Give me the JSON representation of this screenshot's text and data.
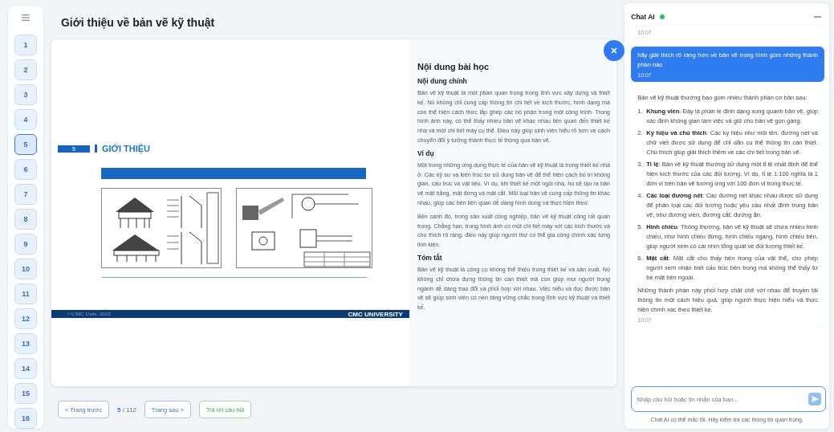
{
  "sidebar": {
    "pages": [
      {
        "label": "1",
        "selected": false
      },
      {
        "label": "2",
        "selected": false
      },
      {
        "label": "3",
        "selected": false
      },
      {
        "label": "4",
        "selected": false
      },
      {
        "label": "5",
        "selected": true
      },
      {
        "label": "6",
        "selected": false
      },
      {
        "label": "7",
        "selected": false
      },
      {
        "label": "8",
        "selected": false
      },
      {
        "label": "9",
        "selected": false
      },
      {
        "label": "10",
        "selected": false
      },
      {
        "label": "11",
        "selected": false
      },
      {
        "label": "12",
        "selected": false
      },
      {
        "label": "13",
        "selected": false
      },
      {
        "label": "14",
        "selected": false
      },
      {
        "label": "15",
        "selected": false
      },
      {
        "label": "16",
        "selected": false
      }
    ]
  },
  "header": {
    "title": "Giới thiệu về bản vẽ kỹ thuật"
  },
  "slide": {
    "number": "5",
    "heading": "GIỚI THIỆU",
    "footer_left": "©CMC Univ. 2022",
    "footer_right": "CMC UNIVERSITY"
  },
  "lesson": {
    "title": "Nội dung bài học",
    "sections": [
      {
        "heading": "Nội dung chính",
        "paragraphs": [
          "Bản vẽ kỹ thuật là một phần quan trọng trong lĩnh vực xây dựng và thiết kế. Nó không chỉ cung cấp thông tin chi tiết về kích thước, hình dạng mà còn thể hiện cách thức lắp ghép các bộ phận trong một công trình. Trong hình ảnh này, có thể thấy nhiều bản vẽ khác nhau liên quan đến thiết kế nhà và một chi tiết máy cụ thể. Điều này giúp sinh viên hiểu rõ hơn về cách chuyển đổi ý tưởng thành thực tế thông qua bản vẽ."
        ]
      },
      {
        "heading": "Ví dụ",
        "paragraphs": [
          "Một trong những ứng dụng thực tế của bản vẽ kỹ thuật là trong thiết kế nhà ở. Các kỹ sư và kiến trúc sư sử dụng bản vẽ để thể hiện cách bố trí không gian, cấu trúc và vật liệu. Ví dụ, khi thiết kế một ngôi nhà, họ sẽ tạo ra bản vẽ mặt bằng, mặt đứng và mặt cắt. Mỗi loại bản vẽ cung cấp thông tin khác nhau, giúp các bên liên quan dễ dàng hình dung và thực hiện theo.",
          "Bên cạnh đó, trong sản xuất công nghiệp, bản vẽ kỹ thuật cũng rất quan trọng. Chẳng hạn, trong hình ảnh có một chi tiết máy với các kích thước và chú thích rõ ràng, điều này giúp người thợ có thể gia công chính xác từng linh kiện."
        ]
      },
      {
        "heading": "Tóm tắt",
        "paragraphs": [
          "Bản vẽ kỹ thuật là công cụ không thể thiếu trong thiết kế và sản xuất. Nó không chỉ chứa đựng thông tin cần thiết mà còn giúp mọi người trong ngành dễ dàng trao đổi và phối hợp với nhau. Việc hiểu và đọc được bản vẽ sẽ giúp sinh viên có nền tảng vững chắc trong lĩnh vực kỹ thuật và thiết kế."
        ]
      }
    ]
  },
  "pager": {
    "prev": "< Trang trước",
    "current": "5",
    "total": "/ 112",
    "next": "Trang sau >",
    "answer": "Trả lời câu hỏi"
  },
  "chat": {
    "title": "Chat AI",
    "online": true,
    "messages": [
      {
        "kind": "bot",
        "time": "10:07"
      },
      {
        "kind": "user",
        "text": "hãy giải thích rõ ràng hơn về bản vẽ trong hình gồm những thành phần nào",
        "time": "10:07"
      },
      {
        "kind": "bot",
        "intro": "Bản vẽ kỹ thuật thường bao gồm nhiều thành phần cơ bản sau:",
        "items": [
          {
            "number": "1.",
            "text": "**Khung viền**: Đây là phần lề định dạng xung quanh bản vẽ, giúp xác định không gian làm việc và giữ cho bản vẽ gọn gàng."
          },
          {
            "number": "2.",
            "text": "**Ký hiệu và chú thích**: Các ký hiệu như mũi tên, đường nét và chữ viết được sử dụng để chỉ dẫn cụ thể thông tin cần thiết. Chú thích giúp giải thích thêm về các chi tiết trong bản vẽ."
          },
          {
            "number": "3.",
            "text": "**Tỉ lệ**: Bản vẽ kỹ thuật thường sử dụng một tỉ lệ nhất định để thể hiện kích thước của các đối tượng. Ví dụ, tỉ lệ 1:100 nghĩa là 1 đơn vị trên bản vẽ tương ứng với 100 đơn vị trong thực tế."
          },
          {
            "number": "4.",
            "text": "**Các loại đường nét**: Các đường nét khác nhau được sử dụng để phân loại các đối tượng hoặc yêu cầu nhất định trong bản vẽ, như đường viền, đường cắt, đường ẩn."
          },
          {
            "number": "5.",
            "text": "**Hình chiếu**: Thông thường, bản vẽ kỹ thuật sẽ chứa nhiều hình chiếu, như hình chiếu đứng, hình chiếu ngang, hình chiếu bên, giúp người xem có cái nhìn tổng quát về đối tượng thiết kế."
          },
          {
            "number": "6.",
            "text": "**Mặt cắt**: Mặt cắt cho thấy bên trong của vật thể, cho phép người xem nhận biết cấu trúc bên trong mà không thể thấy từ bề mặt bên ngoài."
          }
        ],
        "outro": "Những thành phần này phối hợp chặt chẽ với nhau để truyền tải thông tin một cách hiệu quả, giúp người thực hiện hiểu và thực hiện chính xác theo thiết kế.",
        "time": "10:07"
      }
    ],
    "input": {
      "placeholder": "Nhập câu hỏi hoặc tin nhắn của bạn..."
    },
    "disclaimer": "Chat AI có thể mắc lỗi. Hãy kiểm tra các thông tin quan trọng."
  }
}
